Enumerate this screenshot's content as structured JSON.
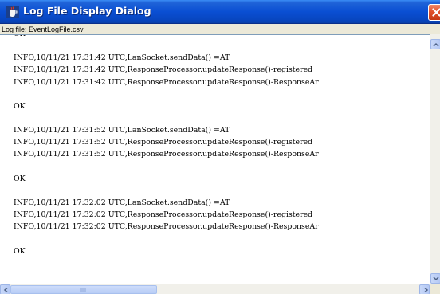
{
  "window": {
    "title": "Log File Display Dialog",
    "app_icon": "java-cup-icon",
    "close_icon": "close-icon"
  },
  "log_file": {
    "label": "Log file: EventLogFile.csv"
  },
  "log": {
    "lines": [
      "OK",
      "",
      "INFO,10/11/21 17:31:42 UTC,LanSocket.sendData() =AT",
      "INFO,10/11/21 17:31:42 UTC,ResponseProcessor.updateResponse()-registered",
      "INFO,10/11/21 17:31:42 UTC,ResponseProcessor.updateResponse()-ResponseAr",
      "",
      "OK",
      "",
      "INFO,10/11/21 17:31:52 UTC,LanSocket.sendData() =AT",
      "INFO,10/11/21 17:31:52 UTC,ResponseProcessor.updateResponse()-registered",
      "INFO,10/11/21 17:31:52 UTC,ResponseProcessor.updateResponse()-ResponseAr",
      "",
      "OK",
      "",
      "INFO,10/11/21 17:32:02 UTC,LanSocket.sendData() =AT",
      "INFO,10/11/21 17:32:02 UTC,ResponseProcessor.updateResponse()-registered",
      "INFO,10/11/21 17:32:02 UTC,ResponseProcessor.updateResponse()-ResponseAr",
      "",
      "OK"
    ]
  },
  "scrollbars": {
    "up_icon": "arrow-up-icon",
    "down_icon": "arrow-down-icon",
    "left_icon": "arrow-left-icon",
    "right_icon": "arrow-right-icon"
  },
  "colors": {
    "titlebar": "#0a4fd3",
    "close_button": "#e0502a",
    "scrollbar_track": "#f1f0ea",
    "scrollbar_button": "#b4c8f4"
  }
}
